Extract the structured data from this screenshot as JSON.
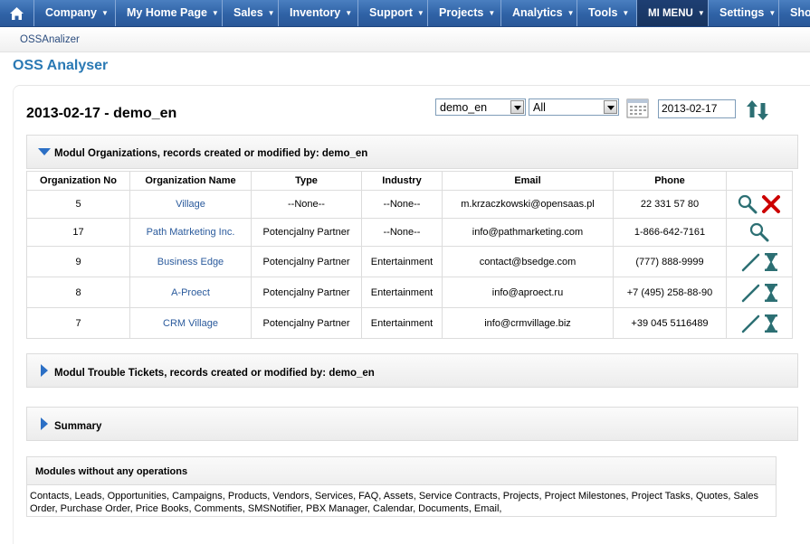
{
  "nav": {
    "items": [
      {
        "label": "Company"
      },
      {
        "label": "My Home Page"
      },
      {
        "label": "Sales"
      },
      {
        "label": "Inventory"
      },
      {
        "label": "Support"
      },
      {
        "label": "Projects"
      },
      {
        "label": "Analytics"
      },
      {
        "label": "Tools"
      },
      {
        "label": "MI MENU"
      },
      {
        "label": "Settings"
      },
      {
        "label": "Sho"
      }
    ],
    "active": "MI MENU"
  },
  "breadcrumb": "OSSAnalizer",
  "page_title": "OSS Analyser",
  "report": {
    "title": "2013-02-17 - demo_en",
    "user_select": "demo_en",
    "filter_select": "All",
    "date": "2013-02-17"
  },
  "sections": {
    "organizations": "Modul Organizations, records created or modified by: demo_en",
    "trouble_tickets": "Modul Trouble Tickets, records created or modified by: demo_en",
    "summary": "Summary"
  },
  "table": {
    "headers": [
      "Organization No",
      "Organization Name",
      "Type",
      "Industry",
      "Email",
      "Phone",
      ""
    ],
    "rows": [
      {
        "no": "5",
        "name": "Village",
        "type": "--None--",
        "industry": "--None--",
        "email": "m.krzaczkowski@opensaas.pl",
        "phone": "22 331 57 80",
        "actions": [
          "search-icon",
          "delete-icon"
        ]
      },
      {
        "no": "17",
        "name": "Path Matrketing Inc.",
        "type": "Potencjalny Partner",
        "industry": "--None--",
        "email": "info@pathmarketing.com",
        "phone": "1-866-642-7161",
        "actions": [
          "search-icon"
        ]
      },
      {
        "no": "9",
        "name": "Business Edge",
        "type": "Potencjalny Partner",
        "industry": "Entertainment",
        "email": "contact@bsedge.com",
        "phone": "(777) 888-9999",
        "actions": [
          "edit-icon",
          "hourglass-icon"
        ]
      },
      {
        "no": "8",
        "name": "A-Proect",
        "type": "Potencjalny Partner",
        "industry": "Entertainment",
        "email": "info@aproect.ru",
        "phone": "+7 (495) 258-88-90",
        "actions": [
          "edit-icon",
          "hourglass-icon"
        ]
      },
      {
        "no": "7",
        "name": "CRM Village",
        "type": "Potencjalny Partner",
        "industry": "Entertainment",
        "email": "info@crmvillage.biz",
        "phone": "+39 045 5116489",
        "actions": [
          "edit-icon",
          "hourglass-icon"
        ]
      }
    ]
  },
  "modules_without_operations": {
    "title": "Modules without any operations",
    "text": "Contacts, Leads, Opportunities, Campaigns, Products, Vendors, Services, FAQ, Assets, Service Contracts, Projects, Project Milestones, Project Tasks, Quotes, Sales Order, Purchase Order, Price Books, Comments, SMSNotifier, PBX Manager, Calendar, Documents, Email,"
  },
  "colors": {
    "nav_bg": "#2f62a6",
    "nav_active": "#1b3a6a",
    "title_blue": "#2a79b4",
    "link_blue": "#2a5a9c",
    "icon_teal": "#2c6f73",
    "delete_red": "#cc0000"
  }
}
